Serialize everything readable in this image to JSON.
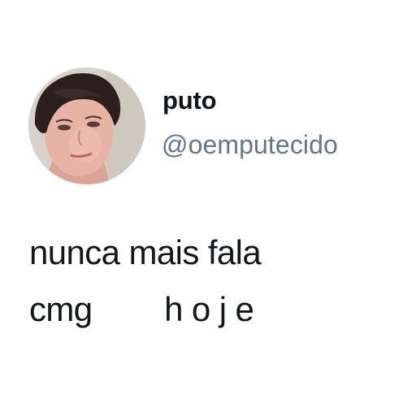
{
  "tweet": {
    "display_name": "puto",
    "handle": "@oemputecido",
    "text_lines": [
      "nunca mais fala",
      "cmg        h o j e"
    ]
  },
  "colors": {
    "background": "#ffffff",
    "name": "#14171a",
    "handle": "#657786",
    "text": "#14171a"
  },
  "icons": {
    "avatar": "user-profile-photo"
  }
}
